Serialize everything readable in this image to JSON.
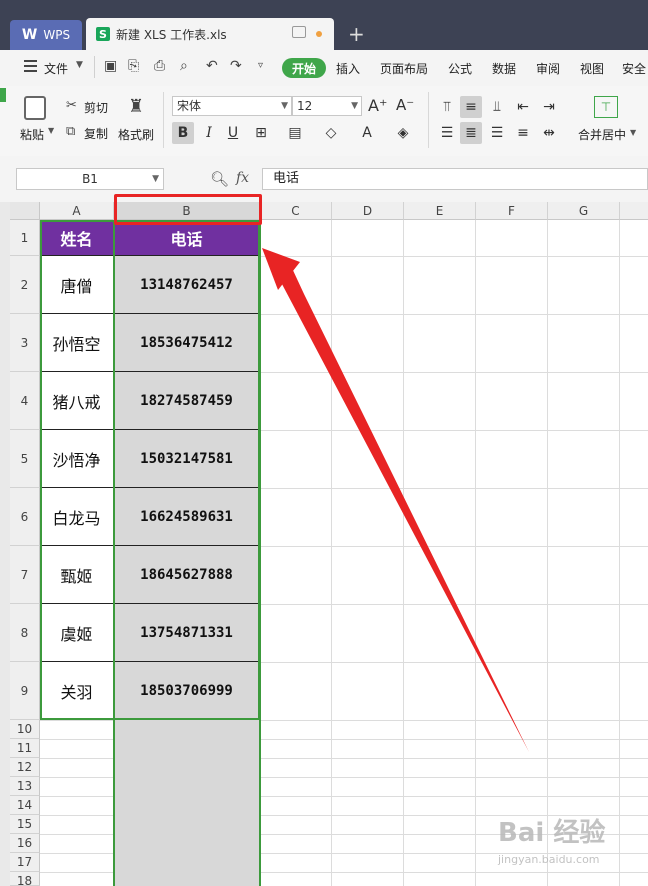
{
  "titlebar": {
    "app_tab": "WPS",
    "file_tab": "新建 XLS 工作表.xls",
    "file_icon": "S",
    "new_tab_symbol": "+"
  },
  "menu": {
    "file": "文件",
    "items": [
      "开始",
      "插入",
      "页面布局",
      "公式",
      "数据",
      "审阅",
      "视图",
      "安全"
    ]
  },
  "ribbon": {
    "paste": "粘贴",
    "cut": "剪切",
    "copy": "复制",
    "format_painter": "格式刷",
    "font_name": "宋体",
    "font_size": "12",
    "merge_center": "合并居中"
  },
  "formula_bar": {
    "name_box": "B1",
    "fx_label": "fx",
    "content": "电话"
  },
  "columns": [
    "A",
    "B",
    "C",
    "D",
    "E",
    "F",
    "G"
  ],
  "rows": [
    "1",
    "2",
    "3",
    "4",
    "5",
    "6",
    "7",
    "8",
    "9",
    "10",
    "11",
    "12",
    "13",
    "14",
    "15",
    "16",
    "17",
    "18"
  ],
  "table": {
    "headers": [
      "姓名",
      "电话"
    ],
    "rows": [
      [
        "唐僧",
        "13148762457"
      ],
      [
        "孙悟空",
        "18536475412"
      ],
      [
        "猪八戒",
        "18274587459"
      ],
      [
        "沙悟净",
        "15032147581"
      ],
      [
        "白龙马",
        "16624589631"
      ],
      [
        "甄姬",
        "18645627888"
      ],
      [
        "虞姬",
        "13754871331"
      ],
      [
        "关羽",
        "18503706999"
      ]
    ]
  },
  "colors": {
    "header_fill": "#7030a0",
    "selection_border": "#3c9a3c",
    "annotation": "#e82424",
    "titlebar": "#3d4254"
  },
  "watermark": "Bai 经验 jingyan.baidu.com"
}
